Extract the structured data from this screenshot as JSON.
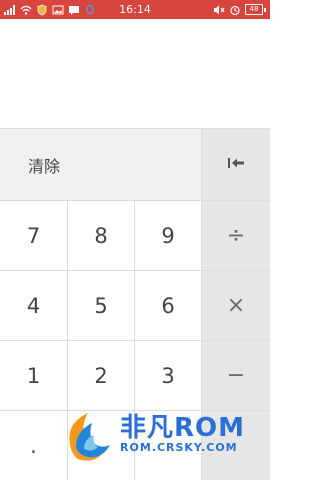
{
  "status_bar": {
    "time": "16:14",
    "battery": "48",
    "bg_color": "#d6453e",
    "left_icons": [
      "signal-icon",
      "wifi-icon",
      "shield-icon",
      "image-icon",
      "message-icon",
      "qq-icon"
    ],
    "right_icons": [
      "mute-icon",
      "alarm-icon",
      "battery-icon"
    ]
  },
  "display": {
    "value": ""
  },
  "keypad": {
    "clear_label": "清除",
    "backspace_icon": "backspace-icon",
    "digits": {
      "seven": "7",
      "eight": "8",
      "nine": "9",
      "four": "4",
      "five": "5",
      "six": "6",
      "one": "1",
      "two": "2",
      "three": "3",
      "dot": "."
    },
    "ops": {
      "divide": "÷",
      "multiply": "×",
      "minus": "−"
    }
  },
  "watermark": {
    "title": "非凡ROM",
    "subtitle": "ROM.CRSKY.COM"
  }
}
